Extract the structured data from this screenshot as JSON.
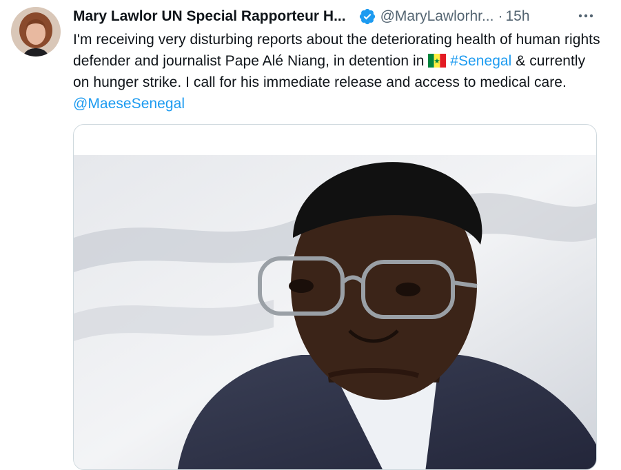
{
  "tweet": {
    "author_name": "Mary Lawlor UN Special Rapporteur H...",
    "handle": "@MaryLawlorhr...",
    "separator": "·",
    "time": "15h",
    "text_part1": "I'm receiving very disturbing reports about the deteriorating health of human rights defender and journalist Pape Alé Niang, in detention in ",
    "hashtag": "#Senegal",
    "text_part2": " & currently on hunger strike. I call for his immediate release and access to medical care. ",
    "mention": "@MaeseSenegal"
  },
  "icons": {
    "verified": "verified-badge-icon",
    "more": "more-options-icon",
    "flag": "senegal-flag-icon"
  },
  "colors": {
    "link": "#1d9bf0",
    "secondary_text": "#536471",
    "border": "#cfd9de"
  }
}
